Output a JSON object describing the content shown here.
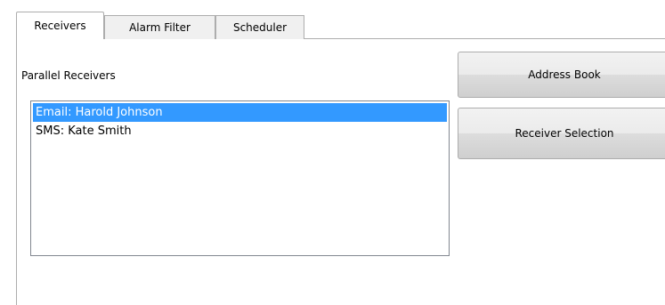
{
  "tabs": [
    {
      "label": "Receivers",
      "selected": true
    },
    {
      "label": "Alarm Filter",
      "selected": false
    },
    {
      "label": "Scheduler",
      "selected": false
    }
  ],
  "receivers_panel": {
    "group_label": "Parallel Receivers",
    "list_items": [
      {
        "text": "Email: Harold Johnson",
        "selected": true
      },
      {
        "text": "SMS: Kate Smith",
        "selected": false
      }
    ],
    "address_book_label": "Address Book",
    "receiver_selection_label": "Receiver Selection"
  },
  "colors": {
    "selection_bg": "#3399ff",
    "selection_text": "#ffffff",
    "button_border": "#adadad",
    "list_border": "#828790"
  }
}
